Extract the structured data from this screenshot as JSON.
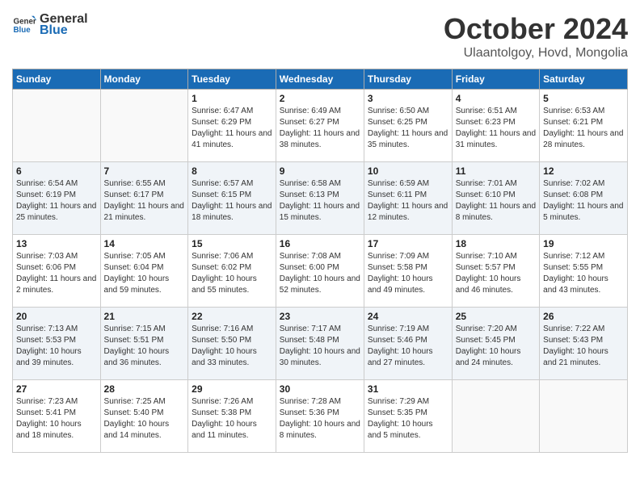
{
  "header": {
    "logo_general": "General",
    "logo_blue": "Blue",
    "month_title": "October 2024",
    "location": "Ulaantolgoy, Hovd, Mongolia"
  },
  "weekdays": [
    "Sunday",
    "Monday",
    "Tuesday",
    "Wednesday",
    "Thursday",
    "Friday",
    "Saturday"
  ],
  "weeks": [
    [
      {
        "day": "",
        "info": ""
      },
      {
        "day": "",
        "info": ""
      },
      {
        "day": "1",
        "info": "Sunrise: 6:47 AM\nSunset: 6:29 PM\nDaylight: 11 hours and 41 minutes."
      },
      {
        "day": "2",
        "info": "Sunrise: 6:49 AM\nSunset: 6:27 PM\nDaylight: 11 hours and 38 minutes."
      },
      {
        "day": "3",
        "info": "Sunrise: 6:50 AM\nSunset: 6:25 PM\nDaylight: 11 hours and 35 minutes."
      },
      {
        "day": "4",
        "info": "Sunrise: 6:51 AM\nSunset: 6:23 PM\nDaylight: 11 hours and 31 minutes."
      },
      {
        "day": "5",
        "info": "Sunrise: 6:53 AM\nSunset: 6:21 PM\nDaylight: 11 hours and 28 minutes."
      }
    ],
    [
      {
        "day": "6",
        "info": "Sunrise: 6:54 AM\nSunset: 6:19 PM\nDaylight: 11 hours and 25 minutes."
      },
      {
        "day": "7",
        "info": "Sunrise: 6:55 AM\nSunset: 6:17 PM\nDaylight: 11 hours and 21 minutes."
      },
      {
        "day": "8",
        "info": "Sunrise: 6:57 AM\nSunset: 6:15 PM\nDaylight: 11 hours and 18 minutes."
      },
      {
        "day": "9",
        "info": "Sunrise: 6:58 AM\nSunset: 6:13 PM\nDaylight: 11 hours and 15 minutes."
      },
      {
        "day": "10",
        "info": "Sunrise: 6:59 AM\nSunset: 6:11 PM\nDaylight: 11 hours and 12 minutes."
      },
      {
        "day": "11",
        "info": "Sunrise: 7:01 AM\nSunset: 6:10 PM\nDaylight: 11 hours and 8 minutes."
      },
      {
        "day": "12",
        "info": "Sunrise: 7:02 AM\nSunset: 6:08 PM\nDaylight: 11 hours and 5 minutes."
      }
    ],
    [
      {
        "day": "13",
        "info": "Sunrise: 7:03 AM\nSunset: 6:06 PM\nDaylight: 11 hours and 2 minutes."
      },
      {
        "day": "14",
        "info": "Sunrise: 7:05 AM\nSunset: 6:04 PM\nDaylight: 10 hours and 59 minutes."
      },
      {
        "day": "15",
        "info": "Sunrise: 7:06 AM\nSunset: 6:02 PM\nDaylight: 10 hours and 55 minutes."
      },
      {
        "day": "16",
        "info": "Sunrise: 7:08 AM\nSunset: 6:00 PM\nDaylight: 10 hours and 52 minutes."
      },
      {
        "day": "17",
        "info": "Sunrise: 7:09 AM\nSunset: 5:58 PM\nDaylight: 10 hours and 49 minutes."
      },
      {
        "day": "18",
        "info": "Sunrise: 7:10 AM\nSunset: 5:57 PM\nDaylight: 10 hours and 46 minutes."
      },
      {
        "day": "19",
        "info": "Sunrise: 7:12 AM\nSunset: 5:55 PM\nDaylight: 10 hours and 43 minutes."
      }
    ],
    [
      {
        "day": "20",
        "info": "Sunrise: 7:13 AM\nSunset: 5:53 PM\nDaylight: 10 hours and 39 minutes."
      },
      {
        "day": "21",
        "info": "Sunrise: 7:15 AM\nSunset: 5:51 PM\nDaylight: 10 hours and 36 minutes."
      },
      {
        "day": "22",
        "info": "Sunrise: 7:16 AM\nSunset: 5:50 PM\nDaylight: 10 hours and 33 minutes."
      },
      {
        "day": "23",
        "info": "Sunrise: 7:17 AM\nSunset: 5:48 PM\nDaylight: 10 hours and 30 minutes."
      },
      {
        "day": "24",
        "info": "Sunrise: 7:19 AM\nSunset: 5:46 PM\nDaylight: 10 hours and 27 minutes."
      },
      {
        "day": "25",
        "info": "Sunrise: 7:20 AM\nSunset: 5:45 PM\nDaylight: 10 hours and 24 minutes."
      },
      {
        "day": "26",
        "info": "Sunrise: 7:22 AM\nSunset: 5:43 PM\nDaylight: 10 hours and 21 minutes."
      }
    ],
    [
      {
        "day": "27",
        "info": "Sunrise: 7:23 AM\nSunset: 5:41 PM\nDaylight: 10 hours and 18 minutes."
      },
      {
        "day": "28",
        "info": "Sunrise: 7:25 AM\nSunset: 5:40 PM\nDaylight: 10 hours and 14 minutes."
      },
      {
        "day": "29",
        "info": "Sunrise: 7:26 AM\nSunset: 5:38 PM\nDaylight: 10 hours and 11 minutes."
      },
      {
        "day": "30",
        "info": "Sunrise: 7:28 AM\nSunset: 5:36 PM\nDaylight: 10 hours and 8 minutes."
      },
      {
        "day": "31",
        "info": "Sunrise: 7:29 AM\nSunset: 5:35 PM\nDaylight: 10 hours and 5 minutes."
      },
      {
        "day": "",
        "info": ""
      },
      {
        "day": "",
        "info": ""
      }
    ]
  ]
}
